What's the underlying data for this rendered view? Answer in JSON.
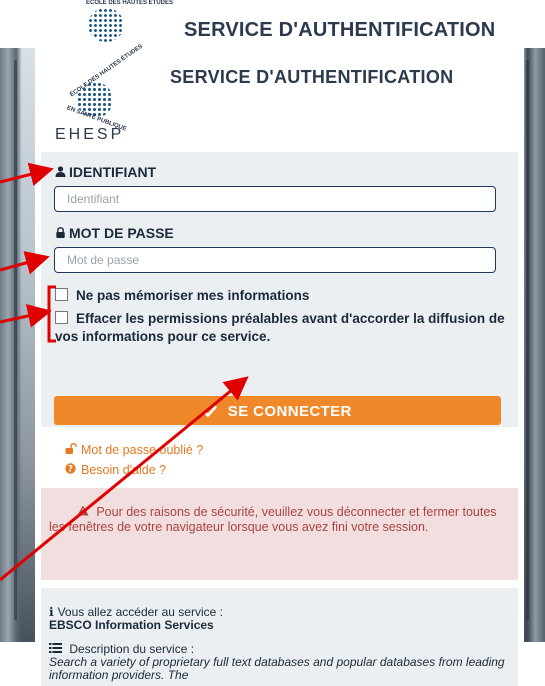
{
  "header": {
    "title": "SERVICE D'AUTHENTIFICATION",
    "seal_top_text": "ÉCOLE DES HAUTES ÉTUDES",
    "seal_bottom_text": "EN SANTÉ PUBLIQUE"
  },
  "brand": {
    "name": "EHESP",
    "title": "SERVICE D'AUTHENTIFICATION"
  },
  "login": {
    "username_label": "IDENTIFIANT",
    "username_placeholder": "Identifiant",
    "password_label": "MOT DE PASSE",
    "password_placeholder": "Mot de passe",
    "remember_label": "Ne pas mémoriser mes informations",
    "clear_permissions_label": "Effacer les permissions préalables avant d'accorder la diffusion de vos informations pour ce service.",
    "connect_label": "SE CONNECTER"
  },
  "links": {
    "forgot_password": "Mot de passe oublié ?",
    "help": "Besoin d'aide ?"
  },
  "warning": {
    "text": "Pour des raisons de sécurité, veuillez vous déconnecter et fermer toutes les fenêtres de votre navigateur lorsque vous avez fini votre session."
  },
  "service": {
    "intro": "Vous allez accéder au service :",
    "name": "EBSCO Information Services",
    "description_label": "Description du service :",
    "description": "Search a variety of proprietary full text databases and popular databases from leading information providers. The"
  },
  "icons": {
    "user": "user-icon",
    "lock": "lock-icon",
    "check": "check-icon",
    "unlock": "unlock-icon",
    "question": "question-circle-icon",
    "warning": "warning-icon",
    "info": "info-icon",
    "list": "list-icon"
  },
  "colors": {
    "accent": "#f0882a",
    "title": "#2b3a4d",
    "warning_bg": "#f2dede",
    "warning_text": "#a94442",
    "annotation": "#e00000"
  }
}
